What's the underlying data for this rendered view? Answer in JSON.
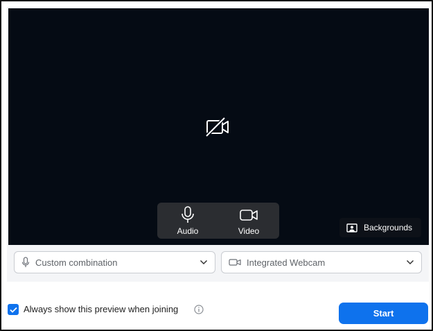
{
  "controls": {
    "audio_label": "Audio",
    "video_label": "Video"
  },
  "backgrounds_label": "Backgrounds",
  "devices": {
    "audio_selected": "Custom combination",
    "video_selected": "Integrated Webcam"
  },
  "preview_option": {
    "label": "Always show this preview when joining",
    "checked": true
  },
  "start_label": "Start",
  "colors": {
    "accent": "#0e72ed",
    "video_background": "#050b14",
    "control_bar": "#2b2d31"
  },
  "icons": [
    "camera-off-icon",
    "microphone-icon",
    "video-camera-icon",
    "background-icon",
    "chevron-down-icon",
    "checkmark-icon",
    "info-icon"
  ]
}
